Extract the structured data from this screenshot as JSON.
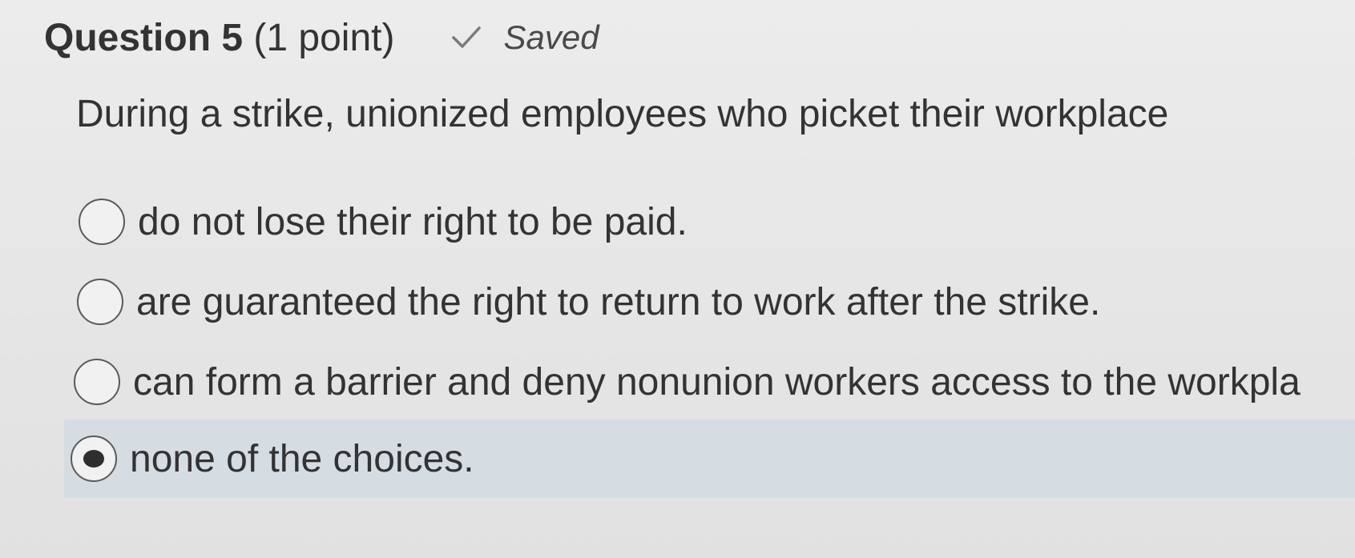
{
  "question": {
    "title": "Question 5",
    "points": "(1 point)",
    "status_icon": "checkmark-icon",
    "status_label": "Saved",
    "prompt": "During a strike, unionized employees who picket their workplace",
    "choices": [
      {
        "label": "do not lose their right to be paid.",
        "selected": false
      },
      {
        "label": "are guaranteed the right to return to work after the strike.",
        "selected": false
      },
      {
        "label": "can form a barrier and deny nonunion workers access to the workpla",
        "selected": false
      },
      {
        "label": "none of the choices.",
        "selected": true
      }
    ]
  },
  "colors": {
    "selected_row": "#d5dde3",
    "text": "#333333",
    "background": "#e9e9e9"
  }
}
